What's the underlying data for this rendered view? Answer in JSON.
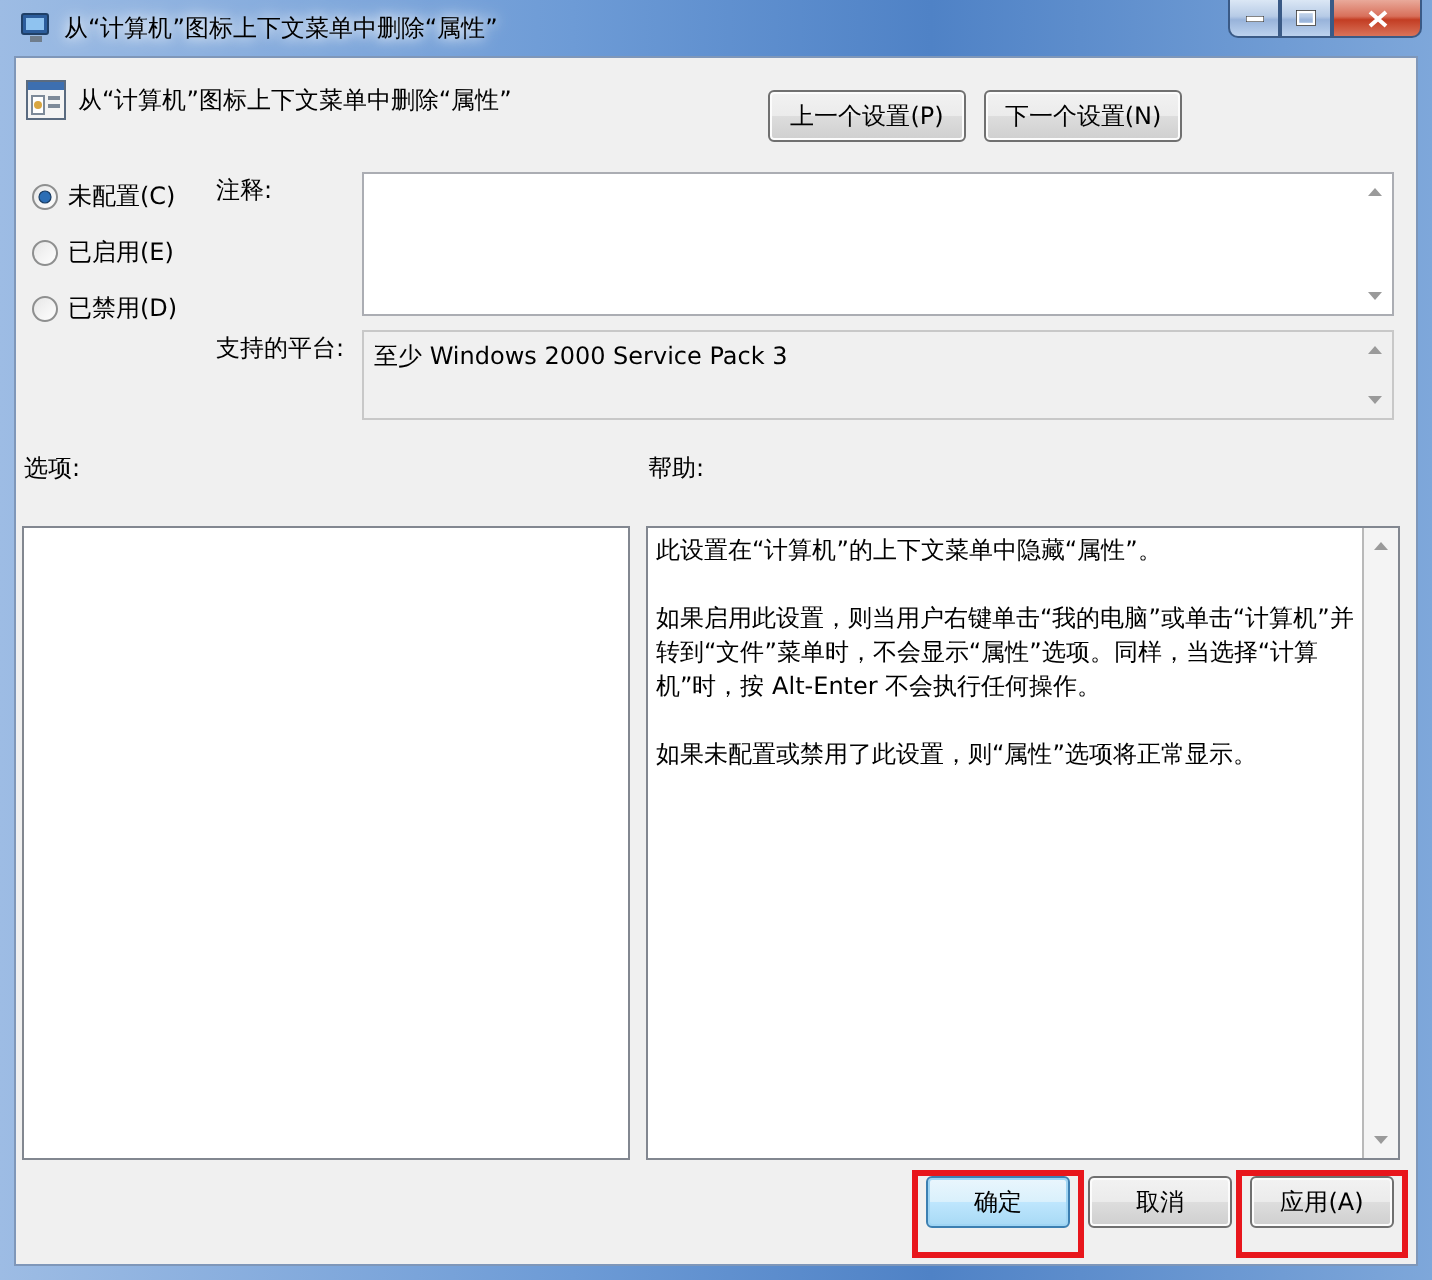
{
  "window": {
    "title": "从“计算机”图标上下文菜单中删除“属性”"
  },
  "header": {
    "title": "从“计算机”图标上下文菜单中删除“属性”",
    "buttons": [
      {
        "label": "上一个设置(P)"
      },
      {
        "label": "下一个设置(N)"
      }
    ]
  },
  "state_options": [
    {
      "label": "未配置(C)",
      "selected": true
    },
    {
      "label": "已启用(E)",
      "selected": false
    },
    {
      "label": "已禁用(D)",
      "selected": false
    }
  ],
  "comment": {
    "label": "注释:"
  },
  "platform": {
    "label": "支持的平台:",
    "value": "至少 Windows 2000 Service Pack 3"
  },
  "options": {
    "label": "选项:"
  },
  "help": {
    "label": "帮助:",
    "paragraphs": [
      "此设置在“计算机”的上下文菜单中隐藏“属性”。",
      "如果启用此设置，则当用户右键单击“我的电脑”或单击“计算机”并转到“文件”菜单时，不会显示“属性”选项。同样，当选择“计算机”时，按 Alt-Enter 不会执行任何操作。",
      "如果未配置或禁用了此设置，则“属性”选项将正常显示。"
    ]
  },
  "footer_buttons": [
    {
      "label": "确定",
      "default": true,
      "highlighted": true
    },
    {
      "label": "取消",
      "default": false,
      "highlighted": false
    },
    {
      "label": "应用(A)",
      "default": false,
      "highlighted": true
    }
  ]
}
